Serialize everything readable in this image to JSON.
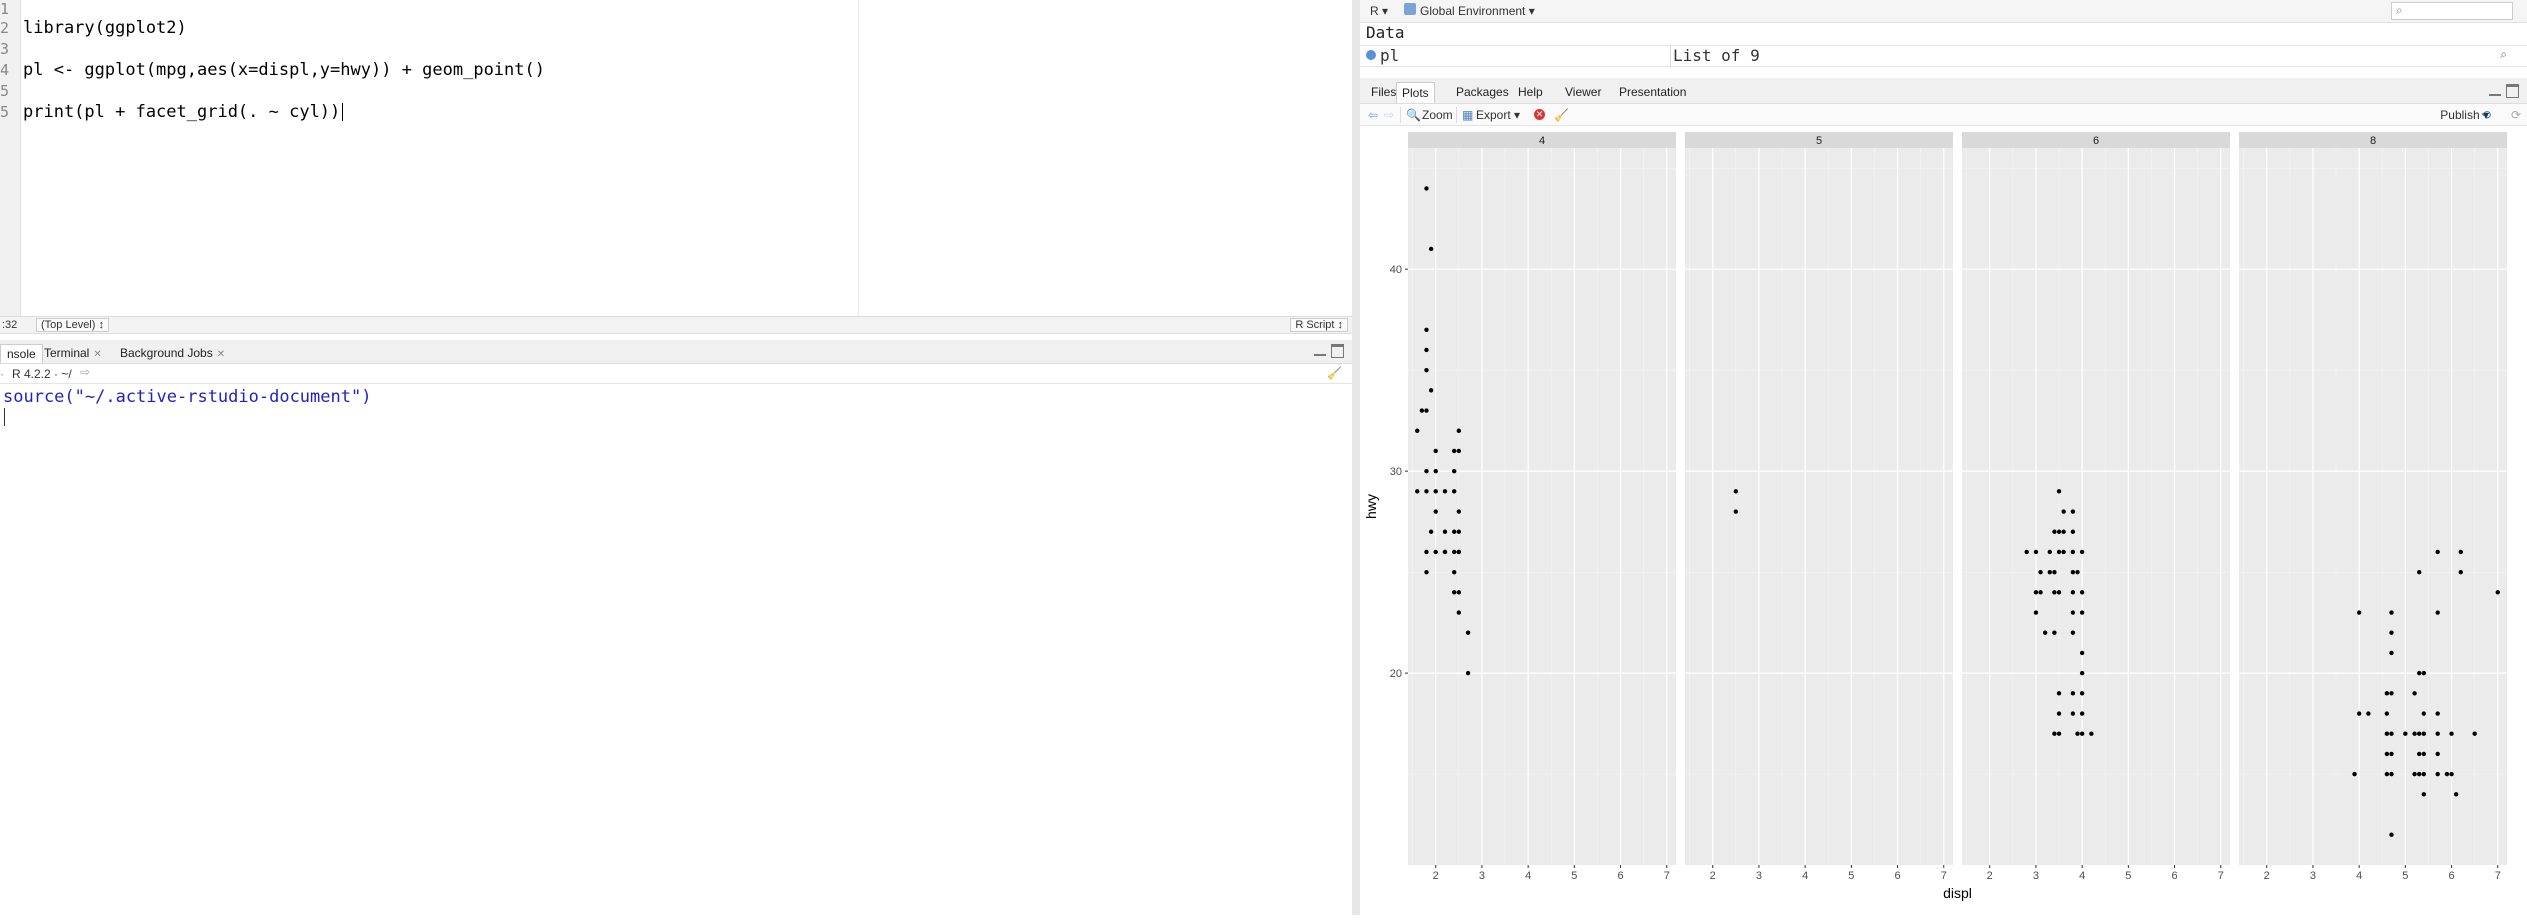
{
  "editor": {
    "lines": [
      {
        "num": "1",
        "code": ""
      },
      {
        "num": "2",
        "code": "library(ggplot2)"
      },
      {
        "num": "3",
        "code": ""
      },
      {
        "num": "4",
        "code": "pl <- ggplot(mpg,aes(x=displ,y=hwy)) + geom_point()"
      },
      {
        "num": "5",
        "code": ""
      },
      {
        "num": "5",
        "code": "print(pl + facet_grid(. ~ cyl))"
      }
    ],
    "status_position": ":32",
    "status_scope": "(Top Level) ↕",
    "status_filetype": "R Script ↕"
  },
  "console": {
    "tabs": [
      "nsole",
      "Terminal",
      "Background Jobs"
    ],
    "version_path": "R 4.2.2 · ~/",
    "command": "source(\"~/.active-rstudio-document\")"
  },
  "environment": {
    "lang_menu": "R ▾",
    "scope_menu": "Global Environment ▾",
    "section": "Data",
    "var_name": "pl",
    "var_value": "List of  9"
  },
  "plots_panel": {
    "tabs": [
      "Files",
      "Plots",
      "Packages",
      "Help",
      "Viewer",
      "Presentation"
    ],
    "active_tab": "Plots",
    "zoom_label": "Zoom",
    "export_label": "Export ▾",
    "publish_label": "Publish ▾"
  },
  "chart_data": {
    "type": "scatter",
    "facet_variable": "cyl",
    "xlabel": "displ",
    "ylabel": "hwy",
    "xlim": [
      1.4,
      7.2
    ],
    "ylim": [
      10.5,
      46.0
    ],
    "x_ticks": [
      2,
      3,
      4,
      5,
      6,
      7
    ],
    "y_ticks": [
      20,
      30,
      40
    ],
    "facets": [
      {
        "label": "4",
        "points": [
          [
            1.8,
            44
          ],
          [
            1.9,
            41
          ],
          [
            1.8,
            37
          ],
          [
            1.8,
            36
          ],
          [
            1.8,
            35
          ],
          [
            1.9,
            34
          ],
          [
            1.8,
            33
          ],
          [
            1.7,
            33
          ],
          [
            1.6,
            32
          ],
          [
            2.5,
            32
          ],
          [
            2.4,
            31
          ],
          [
            2.5,
            31
          ],
          [
            2.0,
            31
          ],
          [
            1.8,
            30
          ],
          [
            2.0,
            30
          ],
          [
            2.4,
            30
          ],
          [
            1.6,
            29
          ],
          [
            1.8,
            29
          ],
          [
            2.0,
            29
          ],
          [
            2.2,
            29
          ],
          [
            2.4,
            29
          ],
          [
            2.0,
            28
          ],
          [
            2.5,
            28
          ],
          [
            1.9,
            27
          ],
          [
            2.2,
            27
          ],
          [
            2.4,
            27
          ],
          [
            2.5,
            27
          ],
          [
            2.0,
            26
          ],
          [
            2.2,
            26
          ],
          [
            2.4,
            26
          ],
          [
            2.5,
            26
          ],
          [
            1.8,
            26
          ],
          [
            2.4,
            25
          ],
          [
            1.8,
            25
          ],
          [
            2.4,
            24
          ],
          [
            2.5,
            24
          ],
          [
            2.5,
            23
          ],
          [
            2.7,
            22
          ],
          [
            2.7,
            20
          ],
          [
            2.2,
            26
          ],
          [
            2.5,
            26
          ]
        ]
      },
      {
        "label": "5",
        "points": [
          [
            2.5,
            29
          ],
          [
            2.5,
            28
          ]
        ]
      },
      {
        "label": "6",
        "points": [
          [
            3.5,
            29
          ],
          [
            3.6,
            28
          ],
          [
            3.8,
            28
          ],
          [
            3.4,
            27
          ],
          [
            3.5,
            27
          ],
          [
            3.6,
            27
          ],
          [
            3.8,
            27
          ],
          [
            3.3,
            26
          ],
          [
            3.5,
            26
          ],
          [
            3.6,
            26
          ],
          [
            3.8,
            26
          ],
          [
            4.0,
            26
          ],
          [
            3.0,
            26
          ],
          [
            3.1,
            25
          ],
          [
            3.3,
            25
          ],
          [
            3.4,
            25
          ],
          [
            3.8,
            25
          ],
          [
            3.9,
            25
          ],
          [
            2.8,
            26
          ],
          [
            3.0,
            24
          ],
          [
            3.1,
            24
          ],
          [
            3.4,
            24
          ],
          [
            3.5,
            24
          ],
          [
            3.8,
            24
          ],
          [
            4.0,
            24
          ],
          [
            3.0,
            23
          ],
          [
            3.8,
            23
          ],
          [
            4.0,
            23
          ],
          [
            3.2,
            22
          ],
          [
            3.4,
            22
          ],
          [
            3.8,
            22
          ],
          [
            4.0,
            21
          ],
          [
            4.0,
            20
          ],
          [
            3.5,
            19
          ],
          [
            3.8,
            19
          ],
          [
            4.0,
            19
          ],
          [
            3.5,
            18
          ],
          [
            3.8,
            18
          ],
          [
            4.0,
            18
          ],
          [
            3.4,
            17
          ],
          [
            3.5,
            17
          ],
          [
            3.9,
            17
          ],
          [
            4.0,
            17
          ],
          [
            4.2,
            17
          ]
        ]
      },
      {
        "label": "8",
        "points": [
          [
            5.7,
            26
          ],
          [
            6.2,
            26
          ],
          [
            6.2,
            25
          ],
          [
            5.3,
            25
          ],
          [
            4.7,
            23
          ],
          [
            5.7,
            23
          ],
          [
            4.0,
            23
          ],
          [
            7.0,
            24
          ],
          [
            4.7,
            22
          ],
          [
            4.7,
            21
          ],
          [
            5.4,
            20
          ],
          [
            5.3,
            20
          ],
          [
            4.7,
            19
          ],
          [
            4.6,
            19
          ],
          [
            5.2,
            19
          ],
          [
            5.4,
            18
          ],
          [
            5.7,
            18
          ],
          [
            4.6,
            18
          ],
          [
            4.0,
            18
          ],
          [
            4.2,
            18
          ],
          [
            4.7,
            17
          ],
          [
            5.0,
            17
          ],
          [
            5.2,
            17
          ],
          [
            5.3,
            17
          ],
          [
            5.4,
            17
          ],
          [
            5.7,
            17
          ],
          [
            6.0,
            17
          ],
          [
            6.5,
            17
          ],
          [
            4.6,
            17
          ],
          [
            3.9,
            15
          ],
          [
            4.7,
            16
          ],
          [
            5.3,
            16
          ],
          [
            5.4,
            16
          ],
          [
            5.7,
            16
          ],
          [
            4.6,
            16
          ],
          [
            4.7,
            15
          ],
          [
            5.2,
            15
          ],
          [
            5.3,
            15
          ],
          [
            5.4,
            15
          ],
          [
            5.7,
            15
          ],
          [
            5.9,
            15
          ],
          [
            6.0,
            15
          ],
          [
            4.6,
            15
          ],
          [
            5.4,
            14
          ],
          [
            6.1,
            14
          ],
          [
            4.7,
            12
          ]
        ]
      }
    ]
  }
}
